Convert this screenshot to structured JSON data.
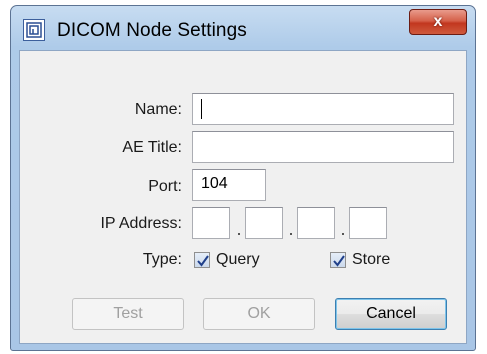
{
  "window": {
    "title": "DICOM Node Settings",
    "close_symbol": "x",
    "icon": "dicom-app-icon"
  },
  "form": {
    "name_label": "Name:",
    "name_value": "",
    "ae_title_label": "AE Title:",
    "ae_title_value": "",
    "port_label": "Port:",
    "port_value": "104",
    "ip_label": "IP Address:",
    "ip_octets": [
      "",
      "",
      "",
      ""
    ],
    "type_label": "Type:",
    "query_label": "Query",
    "query_checked": true,
    "store_label": "Store",
    "store_checked": true
  },
  "buttons": {
    "test_label": "Test",
    "ok_label": "OK",
    "cancel_label": "Cancel"
  },
  "colors": {
    "frame": "#a9c6e6",
    "close": "#c2371f",
    "checkmark": "#1f3f8a"
  }
}
